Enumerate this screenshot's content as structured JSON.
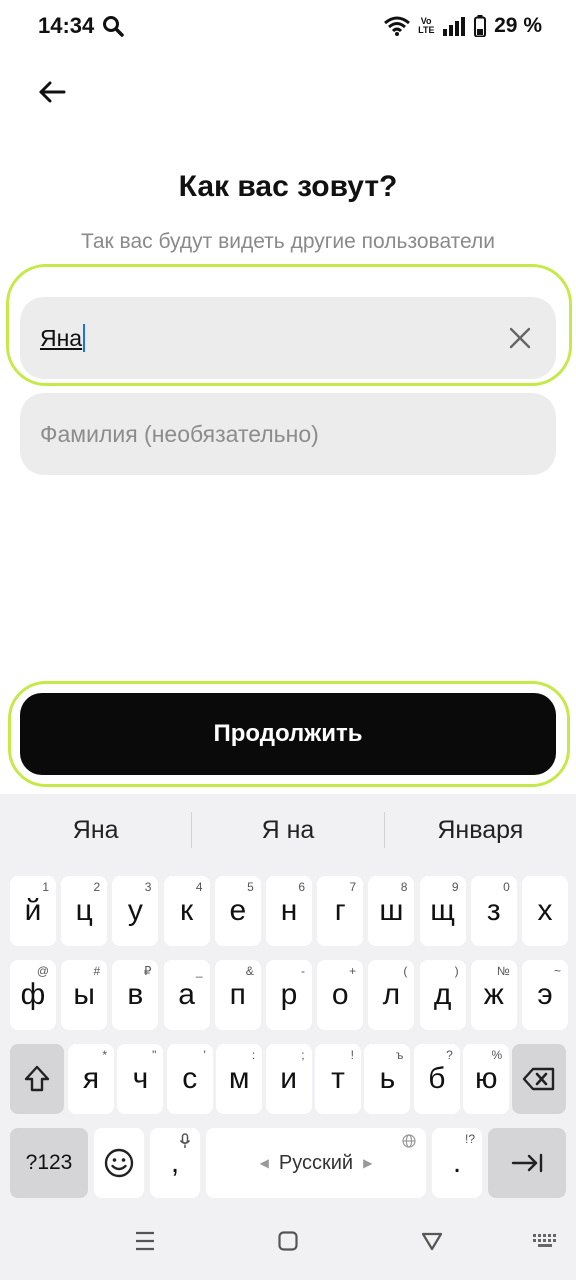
{
  "status_bar": {
    "time": "14:34",
    "volte": "Vo LTE",
    "battery": "29 %"
  },
  "screen": {
    "title": "Как вас зовут?",
    "subtitle": "Так вас будут видеть другие пользователи"
  },
  "form": {
    "first_name_value": "Яна",
    "last_name_placeholder": "Фамилия (необязательно)",
    "continue_label": "Продолжить"
  },
  "keyboard": {
    "suggestions": [
      "Яна",
      "Я на",
      "Января"
    ],
    "row1": [
      {
        "key": "й",
        "hint": "1"
      },
      {
        "key": "ц",
        "hint": "2"
      },
      {
        "key": "у",
        "hint": "3"
      },
      {
        "key": "к",
        "hint": "4"
      },
      {
        "key": "е",
        "hint": "5"
      },
      {
        "key": "н",
        "hint": "6"
      },
      {
        "key": "г",
        "hint": "7"
      },
      {
        "key": "ш",
        "hint": "8"
      },
      {
        "key": "щ",
        "hint": "9"
      },
      {
        "key": "з",
        "hint": "0"
      },
      {
        "key": "х",
        "hint": ""
      }
    ],
    "row2": [
      {
        "key": "ф",
        "hint": "@"
      },
      {
        "key": "ы",
        "hint": "#"
      },
      {
        "key": "в",
        "hint": "₽"
      },
      {
        "key": "а",
        "hint": "_"
      },
      {
        "key": "п",
        "hint": "&"
      },
      {
        "key": "р",
        "hint": "-"
      },
      {
        "key": "о",
        "hint": "+"
      },
      {
        "key": "л",
        "hint": "("
      },
      {
        "key": "д",
        "hint": ")"
      },
      {
        "key": "ж",
        "hint": "№"
      },
      {
        "key": "э",
        "hint": "~"
      }
    ],
    "row3": [
      {
        "key": "я",
        "hint": "*"
      },
      {
        "key": "ч",
        "hint": "\""
      },
      {
        "key": "с",
        "hint": "'"
      },
      {
        "key": "м",
        "hint": ":"
      },
      {
        "key": "и",
        "hint": ";"
      },
      {
        "key": "т",
        "hint": "!"
      },
      {
        "key": "ь",
        "hint": "ъ"
      },
      {
        "key": "б",
        "hint": "?"
      },
      {
        "key": "ю",
        "hint": "%"
      }
    ],
    "symbols_label": "?123",
    "comma": ",",
    "space_label": "Русский",
    "period": ".",
    "period_hint": "!?"
  }
}
